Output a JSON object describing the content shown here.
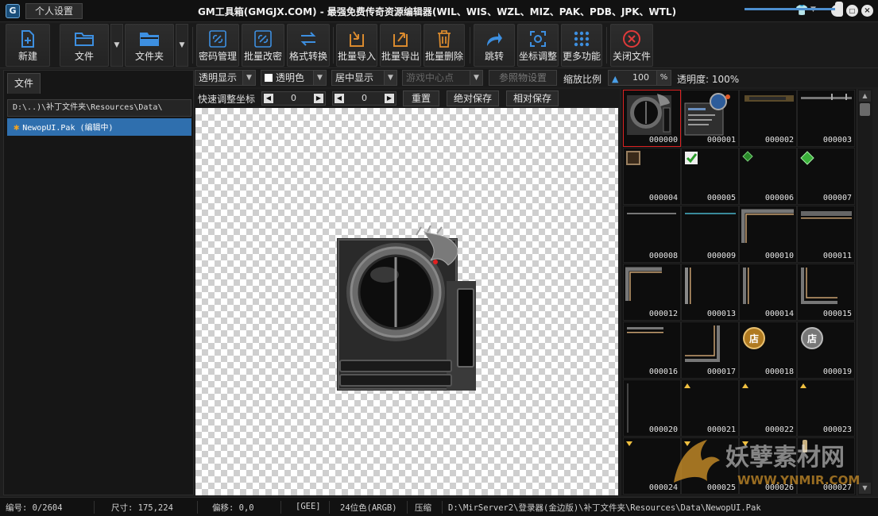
{
  "titlebar": {
    "settings_label": "个人设置",
    "title": "GM工具箱(GMGJX.COM) - 最强免费传奇资源编辑器(WIL、WIS、WZL、MIZ、PAK、PDB、JPK、WTL)",
    "logo_letter": "G"
  },
  "toolbar": {
    "new": "新建",
    "file": "文件",
    "folder": "文件夹",
    "password": "密码管理",
    "batch_pwd": "批量改密",
    "convert": "格式转换",
    "batch_import": "批量导入",
    "batch_export": "批量导出",
    "batch_delete": "批量删除",
    "jump": "跳转",
    "coord": "坐标调整",
    "more": "更多功能",
    "close": "关闭文件",
    "accent": "#3d8fe0",
    "import_color": "#d98a2e",
    "close_color": "#e03a3a"
  },
  "left": {
    "tab": "文件",
    "path": "D:\\..)\\补丁文件夹\\Resources\\Data\\",
    "file": "NewopUI.Pak (编辑中)"
  },
  "options": {
    "transparent_display": "透明显示",
    "transparent_color": "透明色",
    "center_display": "居中显示",
    "game_center": "游戏中心点",
    "ref_setting": "参照物设置",
    "zoom_label": "缩放比例",
    "zoom_value": "100",
    "zoom_unit": "%",
    "opacity_label": "透明度: 100%",
    "opacity": 1.0
  },
  "coords": {
    "label": "快速调整坐标",
    "x": "0",
    "y": "0",
    "reset": "重置",
    "abs_save": "绝对保存",
    "rel_save": "相对保存"
  },
  "thumbs": [
    "000000",
    "000001",
    "000002",
    "000003",
    "000004",
    "000005",
    "000006",
    "000007",
    "000008",
    "000009",
    "000010",
    "000011",
    "000012",
    "000013",
    "000014",
    "000015",
    "000016",
    "000017",
    "000018",
    "000019",
    "000020",
    "000021",
    "000022",
    "000023",
    "000024",
    "000025",
    "000026",
    "000027"
  ],
  "shop_glyph": "店",
  "watermark": {
    "brand": "妖孽素材网",
    "url": "WWW.YNMIR.COM"
  },
  "status": {
    "index": "编号: 0/2604",
    "size": "尺寸: 175,224",
    "offset": "偏移: 0,0",
    "format": "[GEE]",
    "depth": "24位色(ARGB)",
    "compress": "压缩",
    "filepath": "D:\\MirServer2\\登录器(金边版)\\补丁文件夹\\Resources\\Data\\NewopUI.Pak"
  }
}
